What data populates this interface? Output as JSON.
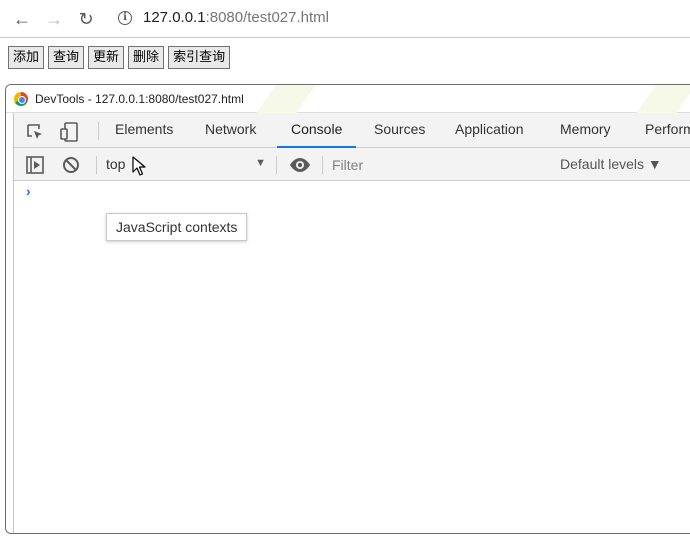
{
  "browser": {
    "url_host": "127.0.0.1",
    "url_rest": ":8080/test027.html",
    "icons": {
      "back": "arrow-left-icon",
      "forward": "arrow-right-icon",
      "reload": "reload-icon",
      "info": "info-icon"
    }
  },
  "page": {
    "buttons": [
      "添加",
      "查询",
      "更新",
      "删除",
      "索引查询"
    ]
  },
  "devtools": {
    "window_title": "DevTools - 127.0.0.1:8080/test027.html",
    "tabs": [
      {
        "label": "Elements",
        "active": false
      },
      {
        "label": "Network",
        "active": false
      },
      {
        "label": "Console",
        "active": true
      },
      {
        "label": "Sources",
        "active": false
      },
      {
        "label": "Application",
        "active": false
      },
      {
        "label": "Memory",
        "active": false
      },
      {
        "label": "Perform",
        "active": false
      }
    ],
    "console": {
      "context": "top",
      "filter_placeholder": "Filter",
      "levels": "Default levels ▼",
      "prompt": "›",
      "tooltip": "JavaScript contexts"
    },
    "colors": {
      "accent": "#1a73e8",
      "toolbar_bg": "#f3f3f3"
    }
  }
}
